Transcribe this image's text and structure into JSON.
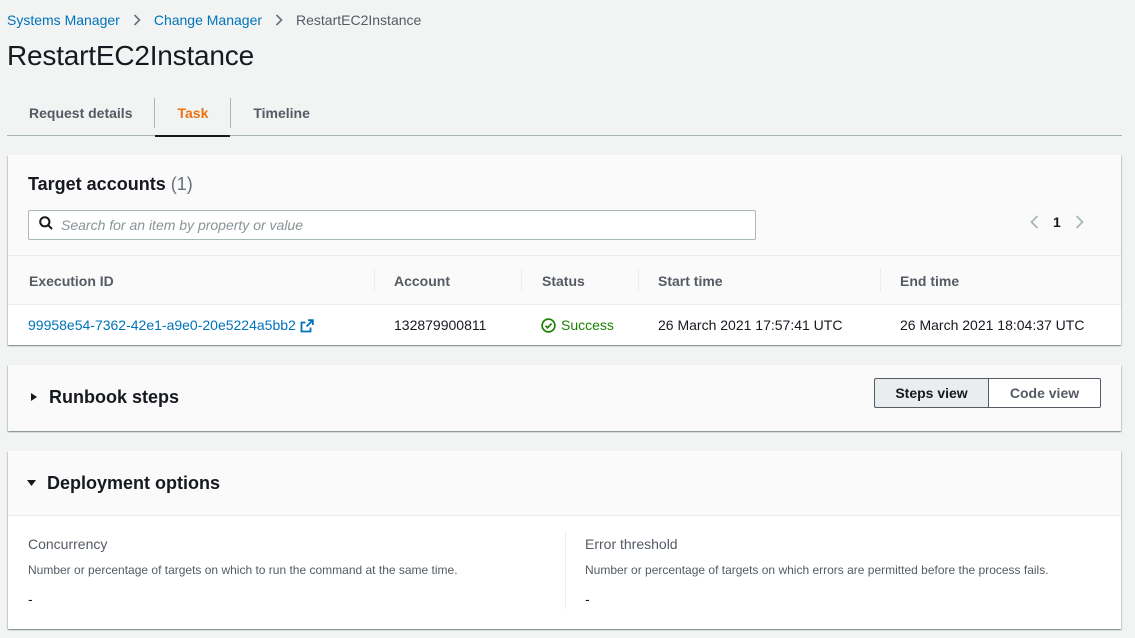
{
  "breadcrumb": {
    "items": [
      "Systems Manager",
      "Change Manager"
    ],
    "current": "RestartEC2Instance"
  },
  "page": {
    "title": "RestartEC2Instance"
  },
  "tabs": [
    {
      "label": "Request details",
      "active": false
    },
    {
      "label": "Task",
      "active": true
    },
    {
      "label": "Timeline",
      "active": false
    }
  ],
  "target_accounts": {
    "title": "Target accounts",
    "count": "(1)",
    "search_placeholder": "Search for an item by property or value",
    "page_number": "1",
    "columns": [
      "Execution ID",
      "Account",
      "Status",
      "Start time",
      "End time"
    ],
    "rows": [
      {
        "execution_id": "99958e54-7362-42e1-a9e0-20e5224a5bb2",
        "account": "132879900811",
        "status": "Success",
        "start_time": "26 March 2021 17:57:41 UTC",
        "end_time": "26 March 2021 18:04:37 UTC"
      }
    ]
  },
  "runbook_steps": {
    "title": "Runbook steps",
    "steps_view_label": "Steps view",
    "code_view_label": "Code view"
  },
  "deployment_options": {
    "title": "Deployment options",
    "concurrency": {
      "label": "Concurrency",
      "description": "Number or percentage of targets on which to run the command at the same time.",
      "value": "-"
    },
    "error_threshold": {
      "label": "Error threshold",
      "description": "Number or percentage of targets on which errors are permitted before the process fails.",
      "value": "-"
    }
  },
  "colors": {
    "link": "#0073bb",
    "active_tab": "#ec7211",
    "success": "#1d8102",
    "background": "#f2f3f3"
  }
}
